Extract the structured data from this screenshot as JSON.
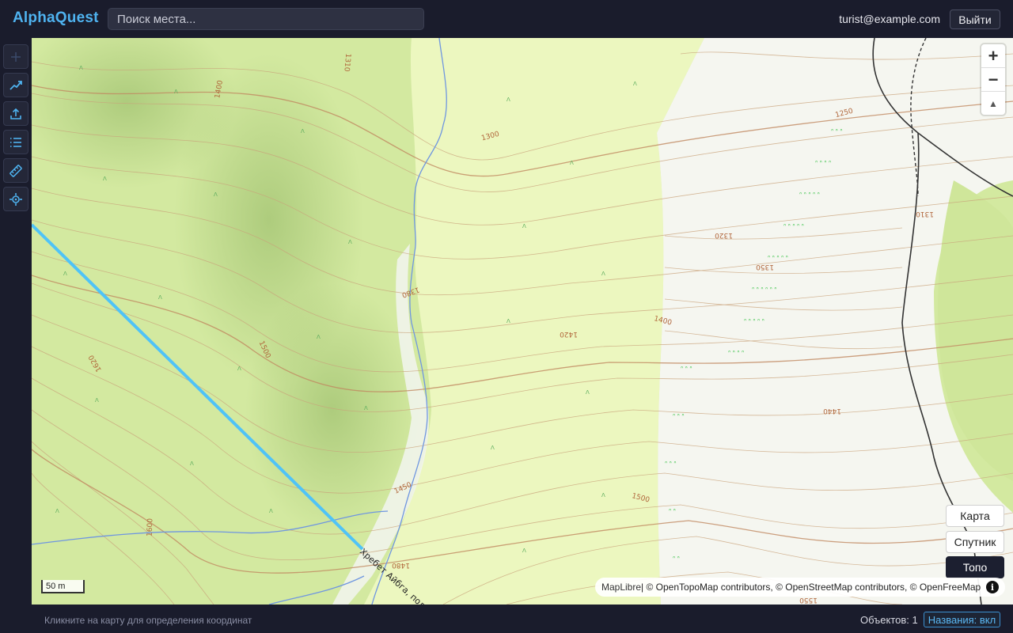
{
  "app": {
    "title": "AlphaQuest"
  },
  "search": {
    "placeholder": "Поиск места..."
  },
  "user": {
    "email": "turist@example.com",
    "logout_label": "Выйти"
  },
  "tools": [
    {
      "icon": "plus-icon"
    },
    {
      "icon": "route-icon"
    },
    {
      "icon": "upload-icon"
    },
    {
      "icon": "list-icon"
    },
    {
      "icon": "ruler-icon"
    },
    {
      "icon": "locate-icon"
    }
  ],
  "map": {
    "contour_labels": [
      "1310",
      "1400",
      "1300",
      "1250",
      "1310",
      "1320",
      "1350",
      "1400",
      "1420",
      "1380",
      "1500",
      "1620",
      "1440",
      "1450",
      "1500",
      "1600",
      "1480",
      "1550"
    ],
    "ridge_label": "Хребет Айбга, подъ",
    "zoom": {
      "in": "+",
      "out": "−",
      "compass": "▲"
    },
    "layers": [
      {
        "label": "Карта",
        "active": false
      },
      {
        "label": "Спутник",
        "active": false
      },
      {
        "label": "Топо",
        "active": true
      }
    ],
    "scale": "50 m",
    "attribution": {
      "maplibre": "MapLibre",
      "rest": " | © OpenTopoMap contributors, © OpenStreetMap contributors, © OpenFreeMap",
      "info": "i"
    }
  },
  "status": {
    "hint": "Кликните на карту для определения координат",
    "count": "Объектов: 1",
    "names_label": "Названия: вкл"
  },
  "colors": {
    "accent": "#4fb3f0",
    "forest": "#cfe69a",
    "meadow": "#f7f7f2",
    "contour": "#c9a27a",
    "route": "#4fc3f7",
    "stream": "#6f96e0"
  }
}
